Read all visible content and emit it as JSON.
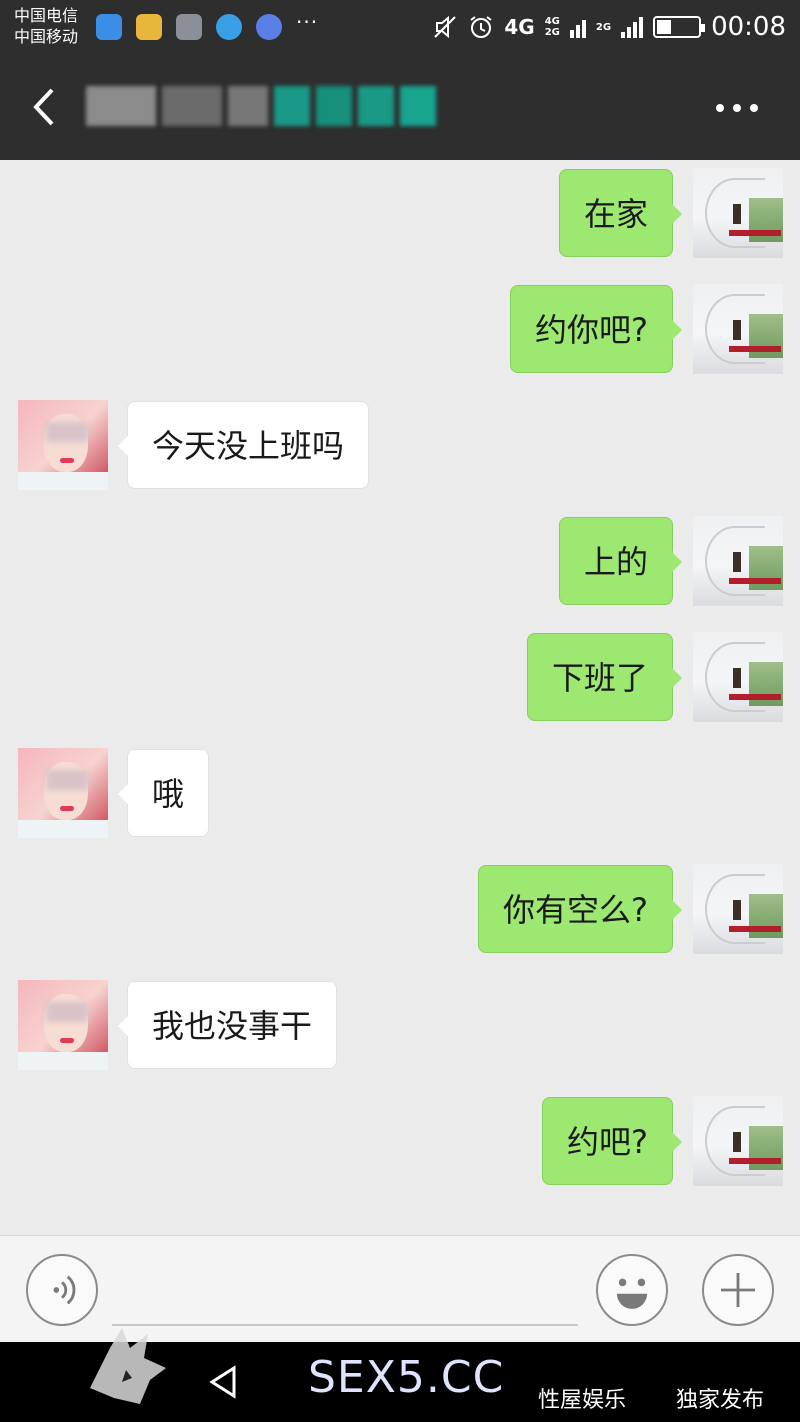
{
  "status_bar": {
    "carrier_top": "中国电信",
    "carrier_bottom": "中国移动",
    "more": "···",
    "network_4g": "4G",
    "network_small_top": "4G",
    "network_small_bottom": "2G",
    "network_2g": "2G",
    "time": "00:08",
    "battery_level": 0.35
  },
  "title_bar": {
    "contact_name_obscured": true
  },
  "messages": [
    {
      "side": "right",
      "text": "在家"
    },
    {
      "side": "right",
      "text": "约你吧?"
    },
    {
      "side": "left",
      "text": "今天没上班吗"
    },
    {
      "side": "right",
      "text": "上的"
    },
    {
      "side": "right",
      "text": "下班了"
    },
    {
      "side": "left",
      "text": "哦"
    },
    {
      "side": "right",
      "text": "你有空么?"
    },
    {
      "side": "left",
      "text": "我也没事干"
    },
    {
      "side": "right",
      "text": "约吧?"
    }
  ],
  "input_bar": {
    "voice_icon": "voice-icon",
    "emoji_icon": "emoji-icon",
    "plus_icon": "plus-icon"
  },
  "watermark": {
    "site": "SEX5.CC",
    "tag_a": "性屋娱乐",
    "tag_b": "独家发布"
  },
  "colors": {
    "bar_dark": "#2e2e2e",
    "chat_bg": "#ebebeb",
    "bubble_sent": "#9de870",
    "bubble_received": "#ffffff"
  }
}
